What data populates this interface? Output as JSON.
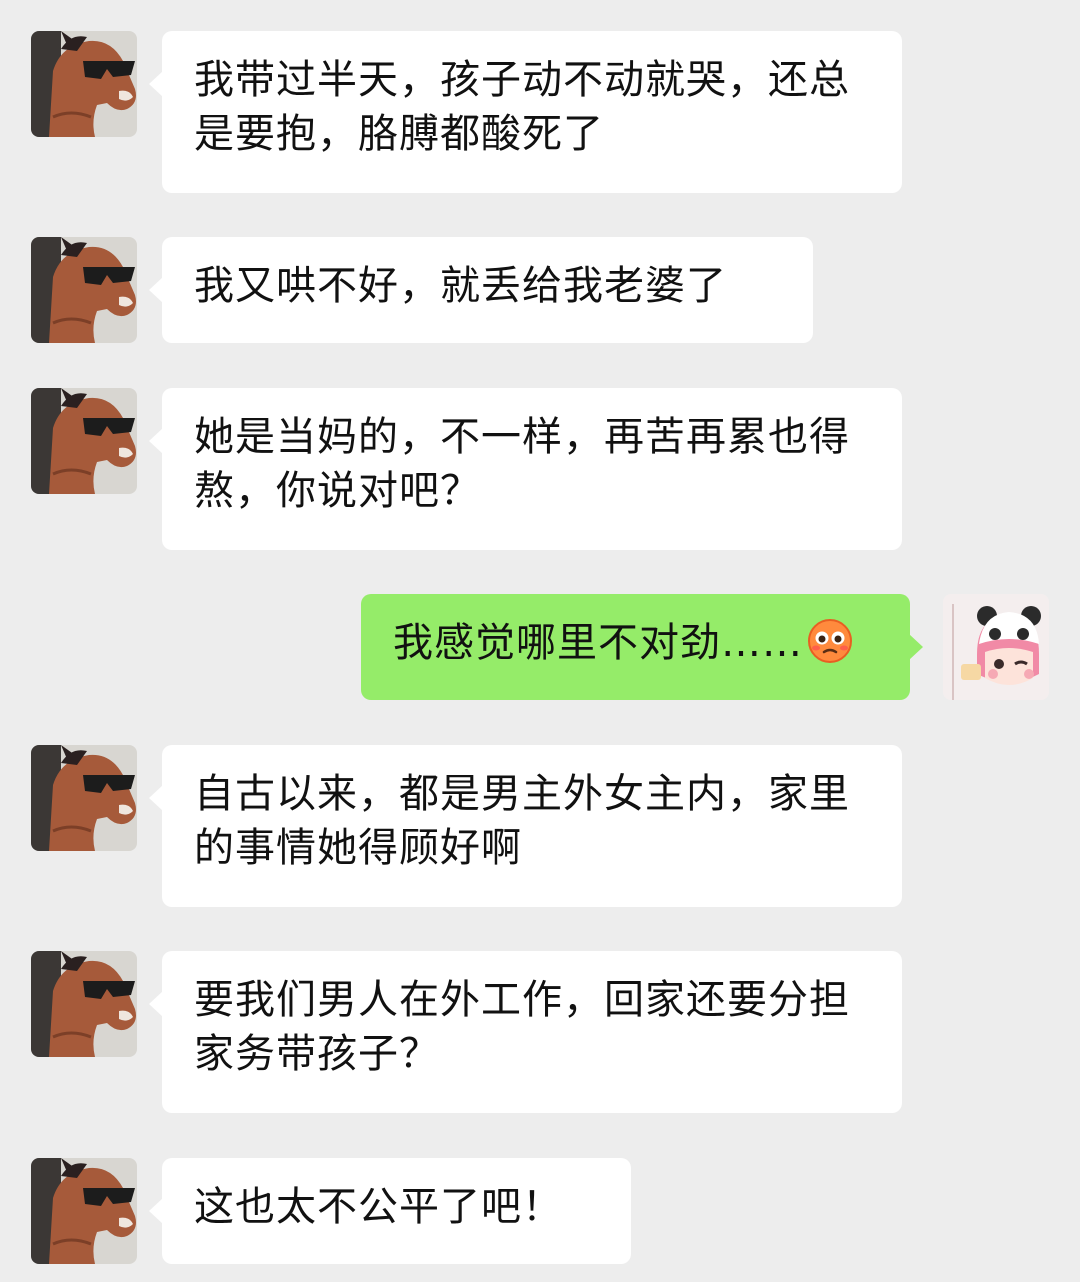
{
  "colors": {
    "background": "#ededed",
    "incoming_bubble": "#ffffff",
    "outgoing_bubble": "#95ec69",
    "text": "#111111"
  },
  "contact_avatar_icon": "horse-with-sunglasses-avatar-icon",
  "self_avatar_icon": "panda-hat-girl-avatar-icon",
  "messages": [
    {
      "side": "left",
      "text": "我带过半天，孩子动不动就哭，还总是要抱，胳膊都酸死了"
    },
    {
      "side": "left",
      "text": "我又哄不好，就丢给我老婆了"
    },
    {
      "side": "left",
      "text": "她是当妈的，不一样，再苦再累也得熬，你说对吧？"
    },
    {
      "side": "right",
      "text": "我感觉哪里不对劲……",
      "emoji": "flushed-face-icon"
    },
    {
      "side": "left",
      "text": "自古以来，都是男主外女主内，家里的事情她得顾好啊"
    },
    {
      "side": "left",
      "text": "要我们男人在外工作，回家还要分担家务带孩子？"
    },
    {
      "side": "left",
      "text": "这也太不公平了吧！"
    }
  ]
}
